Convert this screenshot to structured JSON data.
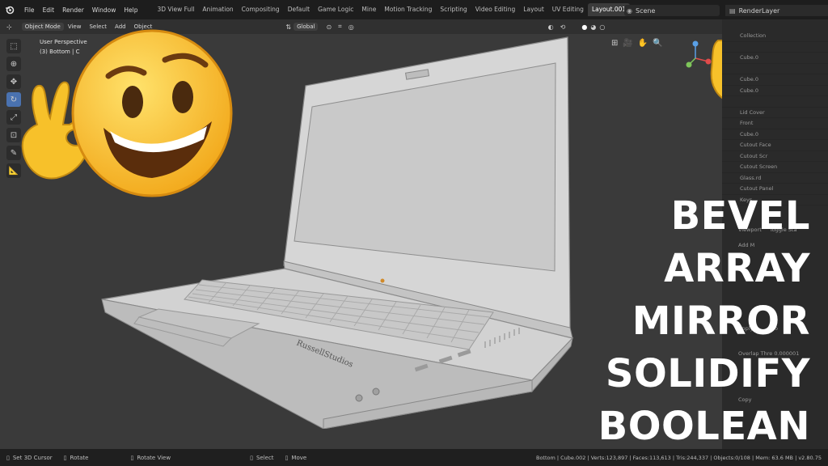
{
  "topbar": {
    "menus": [
      "File",
      "Edit",
      "Render",
      "Window",
      "Help"
    ],
    "workspaces": [
      "3D View Full",
      "Animation",
      "Compositing",
      "Default",
      "Game Logic",
      "Mine",
      "Motion Tracking",
      "Scripting",
      "Video Editing",
      "Layout",
      "UV Editing",
      "Layout.001"
    ],
    "active_workspace": "Layout.001",
    "add_tab": "+",
    "scene": "Scene",
    "render_layer": "RenderLayer"
  },
  "header": {
    "mode": "Object Mode",
    "menus": [
      "View",
      "Select",
      "Add",
      "Object"
    ],
    "orientation": "Global"
  },
  "viewport": {
    "perspective": "User Perspective",
    "collection": "(3) Bottom | C",
    "logo_text": "RussellStudios"
  },
  "outliner": {
    "rows": [
      "Collection",
      "",
      "Cube.0",
      "",
      "Cube.0",
      "Cube.0",
      "",
      "Lid Cover",
      "Front",
      "Cube.0",
      "Cutout Face",
      "Cutout Scr",
      "Cutout Screen",
      "Glass.rd",
      "Cutout Panel",
      "Keys"
    ]
  },
  "properties": {
    "viewport_label": "Viewport",
    "toggle_label": "Toggle Sta",
    "add_label": "Add M",
    "apply_label": "Apply",
    "copy_label": "Co",
    "overlap_label": "Overlap Thre",
    "overlap_value": "0.000001",
    "copy2_label": "Copy"
  },
  "headline": [
    "BEVEL",
    "ARRAY",
    "MIRROR",
    "SOLIDIFY",
    "BOOLEAN"
  ],
  "status": {
    "cursor": "Set 3D Cursor",
    "rotate": "Rotate",
    "rotate_view": "Rotate View",
    "select": "Select",
    "move": "Move",
    "stats": "Bottom | Cube.002 | Verts:123,897 | Faces:113,613 | Tris:244,337 | Objects:0/108 | Mem: 63.6 MB | v2.80.75"
  },
  "colors": {
    "accent": "#4a72b0",
    "emoji_yellow": "#f7c12a"
  }
}
